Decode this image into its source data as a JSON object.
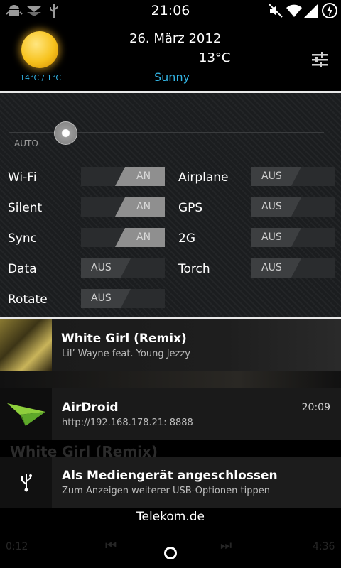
{
  "status_bar": {
    "time": "21:06",
    "left_icons": [
      "android-debug-icon",
      "download-icon",
      "usb-icon"
    ],
    "right_icons": [
      "mute-icon",
      "wifi-icon",
      "signal-icon",
      "battery-charging-icon"
    ]
  },
  "weather": {
    "date": "26. März 2012",
    "temperature": "13°C",
    "condition": "Sunny",
    "temp_range": "14°C / 1°C",
    "icon": "sun-icon",
    "settings_icon": "settings-sliders-icon"
  },
  "brightness": {
    "label": "AUTO",
    "level": 0.18
  },
  "toggles": {
    "left": [
      {
        "label": "Wi-Fi",
        "state": "AN",
        "on": true
      },
      {
        "label": "Silent",
        "state": "AN",
        "on": true
      },
      {
        "label": "Sync",
        "state": "AN",
        "on": true
      },
      {
        "label": "Data",
        "state": "AUS",
        "on": false
      },
      {
        "label": "Rotate",
        "state": "AUS",
        "on": false
      }
    ],
    "right": [
      {
        "label": "Airplane",
        "state": "AUS",
        "on": false
      },
      {
        "label": "GPS",
        "state": "AUS",
        "on": false
      },
      {
        "label": "2G",
        "state": "AUS",
        "on": false
      },
      {
        "label": "Torch",
        "state": "AUS",
        "on": false
      }
    ]
  },
  "notifications": [
    {
      "title": "White Girl (Remix)",
      "subtitle": "Lil’ Wayne feat. Young Jezzy",
      "icon": "album-art"
    },
    {
      "title": "AirDroid",
      "subtitle": "http://192.168.178.21: 8888",
      "time": "20:09",
      "icon": "airdroid-icon"
    },
    {
      "title": "Als Mediengerät angeschlossen",
      "subtitle": "Zum Anzeigen weiterer USB-Optionen tippen",
      "icon": "usb-icon"
    }
  ],
  "background_player": {
    "title": "White Girl (Remix)",
    "elapsed": "0:12",
    "duration": "4:36"
  },
  "carrier": "Telekom.de",
  "colors": {
    "accent": "#33b5e5",
    "switch_on": "#8f8f8f",
    "switch_off": "#3d3f41",
    "panel_bg": "#1b1d1f"
  }
}
